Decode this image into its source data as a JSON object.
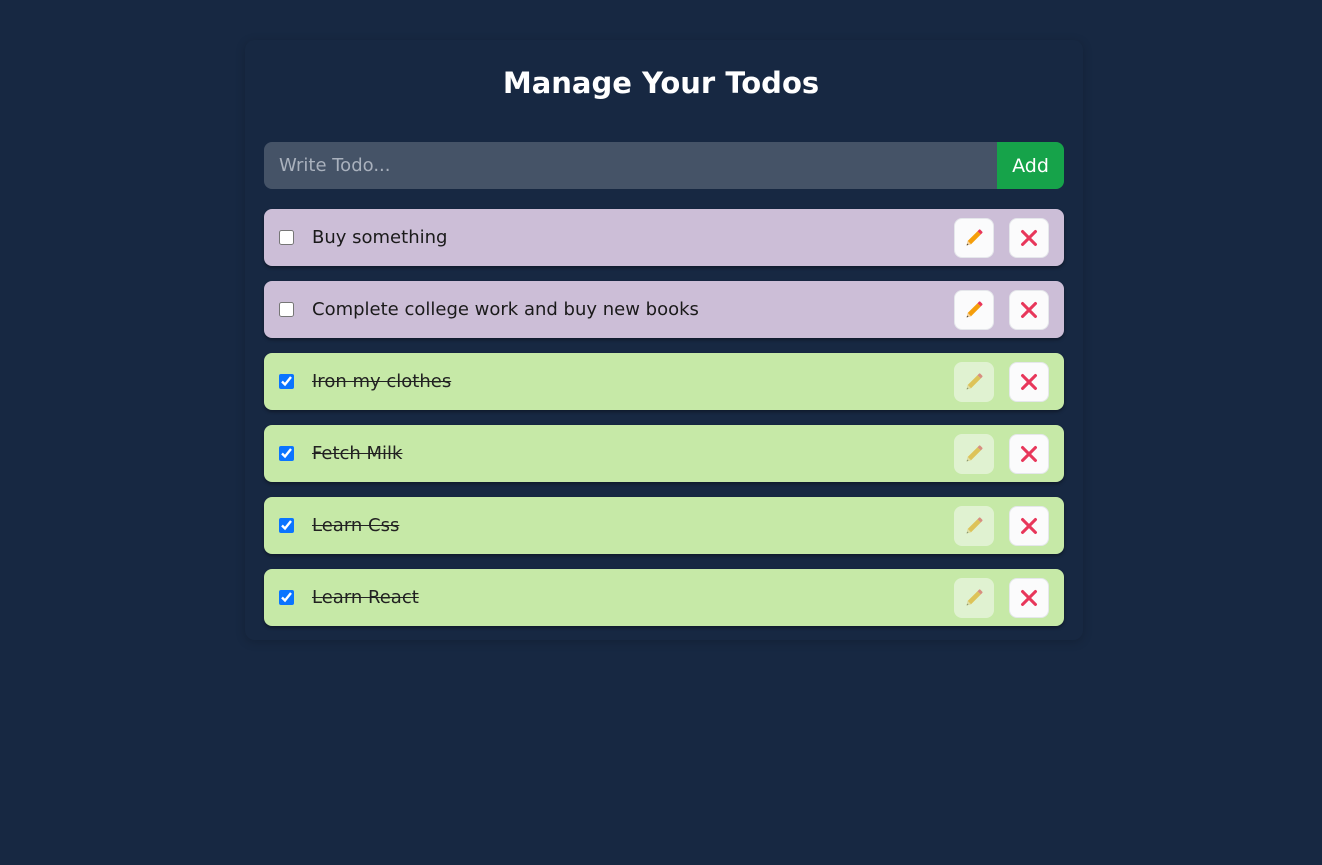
{
  "header": {
    "title": "Manage Your Todos"
  },
  "form": {
    "placeholder": "Write Todo...",
    "value": "",
    "add_label": "Add"
  },
  "todos": [
    {
      "text": "Buy something",
      "completed": false
    },
    {
      "text": "Complete college work and buy new books",
      "completed": false
    },
    {
      "text": "Iron my clothes",
      "completed": true
    },
    {
      "text": "Fetch Milk ",
      "completed": true
    },
    {
      "text": "Learn Css",
      "completed": true
    },
    {
      "text": "Learn React",
      "completed": true
    }
  ],
  "icons": {
    "edit": "pencil-icon",
    "delete": "close-icon"
  },
  "colors": {
    "background": "#172842",
    "pending_item": "#ccbed7",
    "completed_item": "#c6e9a7",
    "add_button": "#16a34a",
    "delete_icon": "#e8375b",
    "edit_icon": "#f59e0b"
  }
}
